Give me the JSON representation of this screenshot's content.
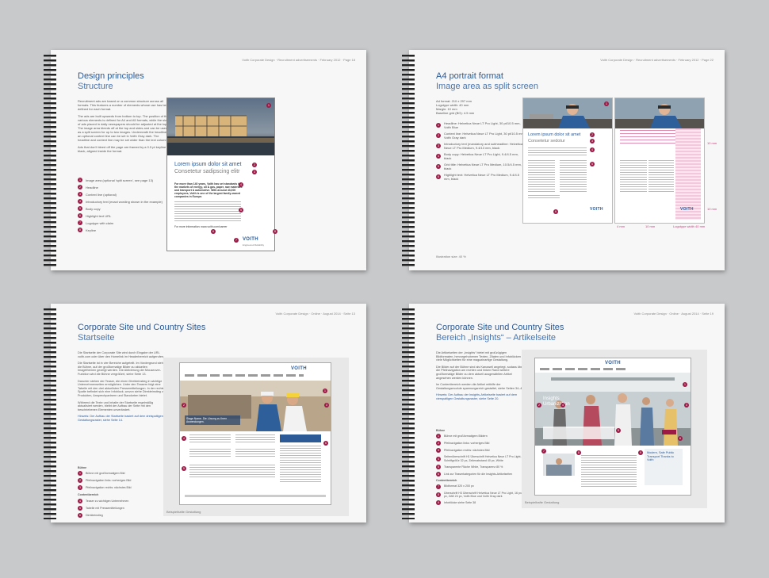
{
  "spreads": [
    {
      "runhead": "Voith Corporate Design · Recruitment advertisements · February 2012 · Page 18",
      "title": "Design principles",
      "subtitle": "Structure",
      "paragraphs": [
        "Recruitment ads are based on a common structure across all formats. This features a number of elements whose use has been defined for each format.",
        "The ads are built upwards from bottom to top. The position of the various elements is defined for A4 and A5 formats, while the size of ads placed in daily newspapers should be adjusted at the top. The image area bleeds off at the top and sides and can be used as a split screen for up to two images. Underneath the headline, an optional context line can be set in Voith Gray dark. The headline and context line may be set wider than the text column.",
        "Ads that don't bleed off the page are framed by a 0.5 pt keyline in black, aligned inside the format."
      ],
      "legend": [
        {
          "n": "1",
          "text": "Image area (optional 'split screen', see page 13)"
        },
        {
          "n": "2",
          "text": "Headline"
        },
        {
          "n": "3",
          "text": "Context line (optional)"
        },
        {
          "n": "4",
          "text": "Introductory text (exact wording shown in the example)"
        },
        {
          "n": "5",
          "text": "Body copy"
        },
        {
          "n": "6",
          "text": "Highlight text URL"
        },
        {
          "n": "7",
          "text": "Logotype with claim"
        },
        {
          "n": "8",
          "text": "Keyline"
        }
      ],
      "ad": {
        "headline": "Lorem ipsum dolor sit amet",
        "context": "Consetetur sadipscing elitr",
        "intro": "For more than 140 years, Voith has set standards in the markets of energy, oil & gas, paper, raw materials and transport & automotive. With around 43,000 employees, Voith is one of the largest family-owned companies in Europe.",
        "url": "For more information: www.voith.com/career",
        "logo": "VOITH",
        "claim": "Engineered Reliability"
      }
    },
    {
      "runhead": "Voith Corporate Design · Recruitment advertisements · February 2012 · Page 22",
      "title": "A4 portrait format",
      "subtitle": "Image area as split screen",
      "specs": [
        "Ad format: 210 x 297 mm",
        "Logotype width: 40 mm",
        "Margin: 10 mm",
        "Baseline grid (BG): 4.5 mm"
      ],
      "legend": [
        {
          "n": "1",
          "text": "Headline: Helvetica Neue LT Pro Light, 30 pt/10.5 mm, Voith Blue"
        },
        {
          "n": "2",
          "text": "Context line: Helvetica Neue LT Pro Light, 30 pt/10.5 mm, Voith Gray dark"
        },
        {
          "n": "3",
          "text": "Introductory text (mandatory and subheadline: Helvetica Neue LT Pro Medium, 9.4/13 mm, black"
        },
        {
          "n": "4",
          "text": "Body copy: Helvetica Neue LT Pro Light, 9.4/4.5 mm, black"
        },
        {
          "n": "5",
          "text": "Grid title: Helvetica Neue LT Pro Medium, 10.5/4.5 mm, black"
        },
        {
          "n": "6",
          "text": "Highlight text: Helvetica Neue LT Pro Medium, 9.4/4.5 mm, black"
        }
      ],
      "ad": {
        "headline": "Lorem ipsum dolor sit amet",
        "context": "Consetetur sedotur",
        "logo": "VOITH"
      },
      "dims": [
        "10 mm",
        "4 mm",
        "10 mm",
        "Logotype width 40 mm",
        "10 mm"
      ],
      "caption": "Illustration size: 40 %"
    },
    {
      "runhead": "Voith Corporate Design · Online · August 2014 · Seite 13",
      "title": "Corporate Site und Country Sites",
      "subtitle": "Startseite",
      "paragraphs": [
        "Die Startseite der Corporate Site wird durch Eingabe der URL voith.com oder über den Homelink im Headerbereich aufgerufen.",
        "Die Startseite ist in vier Bereiche aufgeteilt. Im Vordergrund steht die Bühne, auf der großformatige Bilder zu aktuellen Imagethemen gezeigt werden. Die Aktivierung der Mouseover-Funktion wird die Bühne vergrößert, siehe Seite 13.",
        "Darunter stehen der Teaser, die einen Direkteinstieg in wichtige Unternehmenseiten ermöglichen. Unter den Teasern folgt eine Tabelle mit den drei aktuellsten Pressemitteilungen. In der rechten Spalte befindet sich eine Infoblock, wovon siehe Direkteinstieg zu Produkten, Ansprechpartnern und Standorten bietet.",
        "Während die Texte und Inhalte der Startseite regelmäßig aktualisiert werden, bleibt der Aufbau der Seite mit den beschriebenen Elementen unverändert."
      ],
      "note": "Hinweis: Der Aufbau der Startseite basiert auf dem dreispaltigen Gestaltungsraster, siehe Seite 14.",
      "groups": [
        {
          "title": "Bühne",
          "items": [
            {
              "n": "1",
              "text": "Bühne mit großformatigem Bild"
            },
            {
              "n": "2",
              "text": "Pfeilnavigation links: vorheriges Bild"
            },
            {
              "n": "3",
              "text": "Pfeilnavigation rechts: nächstes Bild"
            }
          ]
        },
        {
          "title": "Contentbereich",
          "items": [
            {
              "n": "4",
              "text": "Teaser zu wichtigen Unternehmen"
            },
            {
              "n": "5",
              "text": "Tabelle mit Pressemitteilungen"
            },
            {
              "n": "6",
              "text": "Direkteinstieg"
            }
          ]
        }
      ],
      "web": {
        "logo": "VOITH",
        "stage_text": "Stage Name. Die Lösung zu Ihren Anwendungen.",
        "caption": "Beispielhafte Gestaltung"
      }
    },
    {
      "runhead": "Voith Corporate Design · Online · August 2014 · Seite 19",
      "title": "Corporate Site und Country Sites",
      "subtitle": "Bereich „Insights“ – Artikelseite",
      "paragraphs": [
        "Die Artikelseiten der „Insights“ bietet mit großzügigen Bildformaten, hervorgehobenen Texten, Zitaten und Infoblöcken viele Möglichkeiten für eine magazinartige Gestaltung.",
        "Die Bilder auf der Bühne sind als Karussell angelegt, sodass über die Pfeilnavigation am rechten und linken Rand weitere großformatige Bilder zu dem aktuell ausgewählten Artikel angesehen werden können.",
        "Im Contentbereich werden die Artikel mithilfe der Gestaltungsmodule spannungsreich gestaltet, siehe Seiten 34–45."
      ],
      "note": "Hinweis: Der Aufbau der Insights-Artikelseite basiert auf dem vierspaltigen Gestaltungsraster, siehe Seite 20.",
      "groups": [
        {
          "title": "Bühne",
          "items": [
            {
              "n": "1",
              "text": "Bühne mit großformatigem Bildern"
            },
            {
              "n": "2",
              "text": "Pfeilnavigation links: vorheriges Bild"
            },
            {
              "n": "3",
              "text": "Pfeilnavigation rechts: nächstes Bild"
            },
            {
              "n": "4",
              "text": "Seitenüberschrift H1 Überschrift Helvetica Neue LT Pro Light, Schriftgröße 32 px, Zeilenabstand 40 px, White"
            },
            {
              "n": "5",
              "text": "Transparente Fläche White, Transparenz 80 %"
            },
            {
              "n": "6",
              "text": "Link zur Teaserkategorien für die Insights-Artikelseiten"
            }
          ]
        },
        {
          "title": "Contentbereich",
          "items": [
            {
              "n": "7",
              "text": "Bildformat 320 x 200 px"
            },
            {
              "n": "8",
              "text": "Überschrift H3 Überschrift Helvetica Neue LT Pro Light, 16 px/24 px, ZAB 24 px, Voith Blue und Voith Gray dark"
            },
            {
              "n": "9",
              "text": "Infoblöcke siehe Seite 38"
            }
          ]
        }
      ],
      "web": {
        "logo": "VOITH",
        "stage_title": "Insights Urbanization",
        "teaser": "Modern, Safe Public Transport Thanks to Voith",
        "caption": "Beispielhafte Gestaltung"
      }
    }
  ],
  "colors": {
    "voith_blue": "#2b5a97",
    "marker": "#9b1b46",
    "pink_grid": "#e08ab0"
  }
}
